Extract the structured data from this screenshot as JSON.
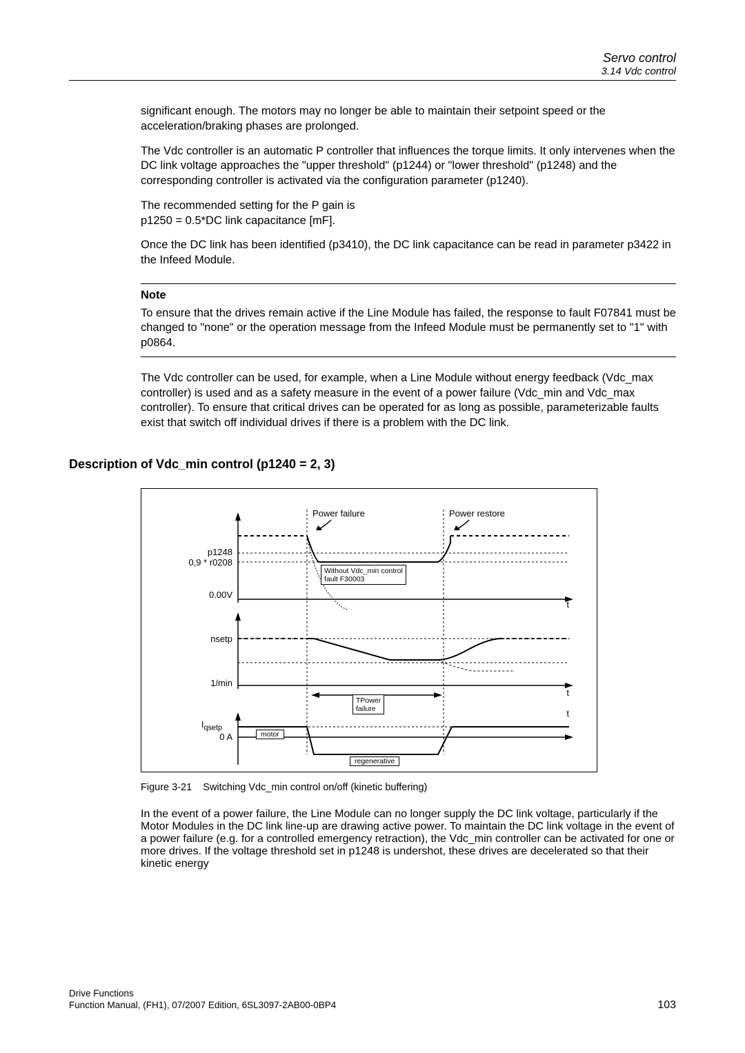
{
  "header": {
    "chapter": "Servo control",
    "section": "3.14 Vdc control"
  },
  "body": {
    "p1": "significant enough. The motors may no longer be able to maintain their setpoint speed or the acceleration/braking phases are prolonged.",
    "p2": "The Vdc controller is an automatic P controller that influences the torque limits. It only intervenes when the DC link voltage approaches the \"upper threshold\" (p1244) or \"lower threshold\" (p1248) and the corresponding controller is activated via the configuration parameter (p1240).",
    "p3a": "The recommended setting for the P gain is",
    "p3b": "p1250 = 0.5*DC link capacitance [mF].",
    "p4": "Once the DC link has been identified (p3410), the DC link capacitance can be read in parameter p3422 in the Infeed Module.",
    "note_label": "Note",
    "note_body": "To ensure that the drives remain active if the Line Module has failed, the response to fault F07841 must be changed to \"none\" or the operation message from the Infeed Module must be permanently set to \"1\" with p0864.",
    "p5": "The Vdc controller can be used, for example, when a Line Module without energy feedback (Vdc_max controller) is used and as a safety measure in the event of a power failure (Vdc_min and Vdc_max controller). To ensure that critical drives can be operated for as long as possible, parameterizable faults exist that switch off individual drives if there is a problem with the DC link.",
    "sect_head": "Description of Vdc_min control (p1240 = 2, 3)",
    "fig": {
      "power_failure": "Power failure",
      "power_restore": "Power restore",
      "p1248": "p1248",
      "r0208": "0,9 * r0208",
      "zero_v": "0.00V",
      "without_vdc1": "Without Vdc_min control",
      "without_vdc2": "fault F30003",
      "nsetp": "nsetp",
      "one_min": "1/min",
      "tpower1": "TPower",
      "tpower2": "failure",
      "iqsetp": "I",
      "iqsetp_sub": "qsetp",
      "zero_a": "0 A",
      "motor": "motor",
      "regenerative": "regenerative",
      "t": "t"
    },
    "fig_caption_label": "Figure 3-21",
    "fig_caption_text": "Switching Vdc_min control on/off (kinetic buffering)",
    "p6": "In the event of a power failure, the Line Module can no longer supply the DC link voltage, particularly if the Motor Modules in the DC link line-up are drawing active power. To maintain the DC link voltage in the event of a power failure (e.g. for a controlled emergency retraction), the Vdc_min controller can be activated for one or more drives. If the voltage threshold set in p1248 is undershot, these drives are decelerated so that their kinetic energy"
  },
  "footer": {
    "line1": "Drive Functions",
    "line2": "Function Manual, (FH1), 07/2007 Edition, 6SL3097-2AB00-0BP4",
    "page": "103"
  }
}
